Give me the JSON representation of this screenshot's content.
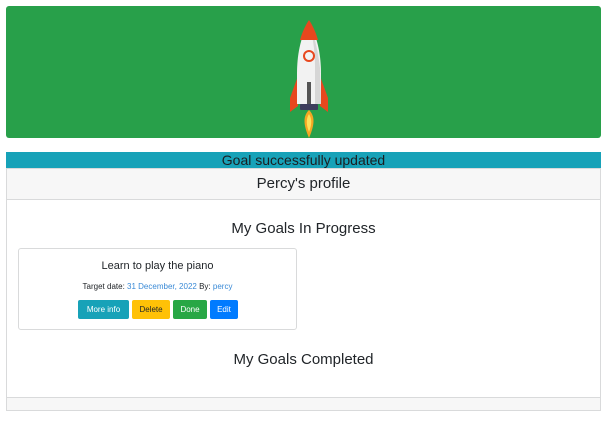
{
  "hero": {
    "icon": "rocket-icon",
    "background": "#28a04a"
  },
  "alert": {
    "message": "Goal successfully updated",
    "color": "#17a2b8"
  },
  "profile": {
    "header": "Percy's profile"
  },
  "in_progress": {
    "title": "My Goals In Progress",
    "goals": [
      {
        "title": "Learn to play the piano",
        "target_label": "Target date:",
        "target_date": "31 December, 2022",
        "by_label": "By:",
        "author": "percy",
        "buttons": {
          "more_info": "More info",
          "delete": "Delete",
          "done": "Done",
          "edit": "Edit"
        }
      }
    ]
  },
  "completed": {
    "title": "My Goals Completed"
  }
}
